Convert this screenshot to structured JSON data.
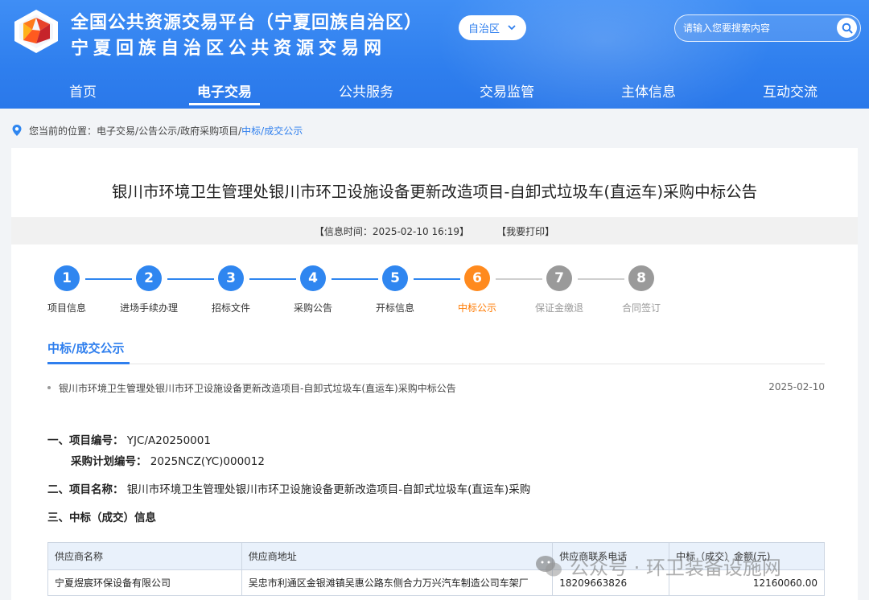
{
  "header": {
    "title_line1": "全国公共资源交易平台（宁夏回族自治区）",
    "title_line2": "宁夏回族自治区公共资源交易网",
    "region_select": "自治区",
    "search_placeholder": "请输入您要搜索内容",
    "logo_icon": "platform-logo-icon",
    "colors": {
      "brand_blue": "#2f7fee",
      "active_step": "#ff8a1e",
      "inactive_step": "#9a9a9a"
    }
  },
  "nav": {
    "items": [
      {
        "label": "首页"
      },
      {
        "label": "电子交易",
        "active": true
      },
      {
        "label": "公共服务"
      },
      {
        "label": "交易监管"
      },
      {
        "label": "主体信息"
      },
      {
        "label": "互动交流"
      }
    ]
  },
  "breadcrumb": {
    "prefix": "您当前的位置：",
    "items": [
      "电子交易/",
      "公告公示/",
      "政府采购项目/"
    ],
    "current": "中标/成交公示"
  },
  "document": {
    "title": "银川市环境卫生管理处银川市环卫设施设备更新改造项目-自卸式垃圾车(直运车)采购中标公告",
    "info_time": "【信息时间：2025-02-10 16:19】",
    "print_label": "【我要打印】"
  },
  "steps": [
    {
      "num": "1",
      "label": "项目信息",
      "state": "done"
    },
    {
      "num": "2",
      "label": "进场手续办理",
      "state": "done"
    },
    {
      "num": "3",
      "label": "招标文件",
      "state": "done"
    },
    {
      "num": "4",
      "label": "采购公告",
      "state": "done"
    },
    {
      "num": "5",
      "label": "开标信息",
      "state": "done"
    },
    {
      "num": "6",
      "label": "中标公示",
      "state": "current"
    },
    {
      "num": "7",
      "label": "保证金缴退",
      "state": "todo"
    },
    {
      "num": "8",
      "label": "合同签订",
      "state": "todo"
    }
  ],
  "section": {
    "tab_label": "中标/成交公示",
    "notice_title": "银川市环境卫生管理处银川市环卫设施设备更新改造项目-自卸式垃圾车(直运车)采购中标公告",
    "notice_date": "2025-02-10"
  },
  "content": {
    "item1_label": "一、项目编号：",
    "item1_value": "YJC/A20250001",
    "plan_label": "采购计划编号：",
    "plan_value": "2025NCZ(YC)000012",
    "item2_label": "二、项目名称：",
    "item2_value": "银川市环境卫生管理处银川市环卫设施设备更新改造项目-自卸式垃圾车(直运车)采购",
    "item3_label": "三、中标（成交）信息"
  },
  "table": {
    "headers": [
      "供应商名称",
      "供应商地址",
      "供应商联系电话",
      "中标（成交）金额(元)"
    ],
    "rows": [
      [
        "宁夏煜宸环保设备有限公司",
        "吴忠市利通区金银滩镇吴惠公路东侧合力万兴汽车制造公司车架厂",
        "18209663826",
        "12160060.00"
      ]
    ]
  },
  "watermark": {
    "text": "公众号 · 环卫装备设施网",
    "icon": "wechat-icon"
  }
}
